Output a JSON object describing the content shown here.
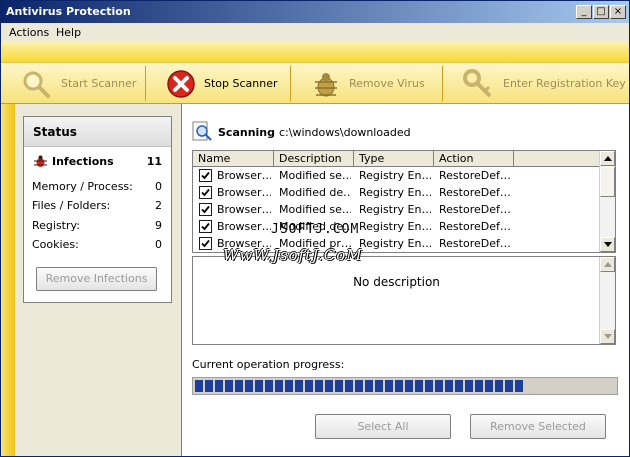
{
  "window": {
    "title": "Antivirus Protection"
  },
  "menu": [
    "Actions",
    "Help"
  ],
  "toolbar": {
    "start_scanner": "Start Scanner",
    "stop_scanner": "Stop Scanner",
    "remove_virus": "Remove Virus",
    "registration": "Enter Registration Key"
  },
  "status": {
    "title": "Status",
    "infections_label": "Infections",
    "infections_count": "11",
    "rows": [
      {
        "label": "Memory / Process:",
        "value": "0"
      },
      {
        "label": "Files / Folders:",
        "value": "2"
      },
      {
        "label": "Registry:",
        "value": "9"
      },
      {
        "label": "Cookies:",
        "value": "0"
      }
    ],
    "remove_infections": "Remove Infections"
  },
  "scan": {
    "label": "Scanning",
    "path": "c:\\windows\\downloaded"
  },
  "table": {
    "headers": [
      "Name",
      "Description",
      "Type",
      "Action"
    ],
    "rows": [
      {
        "name": "Browser…",
        "description": "Modified se…",
        "type": "Registry En…",
        "action": "RestoreDef…"
      },
      {
        "name": "Browser…",
        "description": "Modified de…",
        "type": "Registry En…",
        "action": "RestoreDef…"
      },
      {
        "name": "Browser…",
        "description": "Modified se…",
        "type": "Registry En…",
        "action": "RestoreDef…"
      },
      {
        "name": "Browser…",
        "description": "Modified de…",
        "type": "Registry En…",
        "action": "RestoreDef…"
      },
      {
        "name": "Browser…",
        "description": "Modified pr…",
        "type": "Registry En…",
        "action": "RestoreDef…"
      }
    ]
  },
  "description": {
    "text": "No description"
  },
  "progress": {
    "label": "Current operation progress:",
    "fraction": 0.78
  },
  "buttons": {
    "select_all": "Select All",
    "remove_selected": "Remove Selected"
  },
  "watermark": {
    "line1": "JSOFTJ.COM",
    "line2": "WwW.JsoftJ.CoM"
  }
}
